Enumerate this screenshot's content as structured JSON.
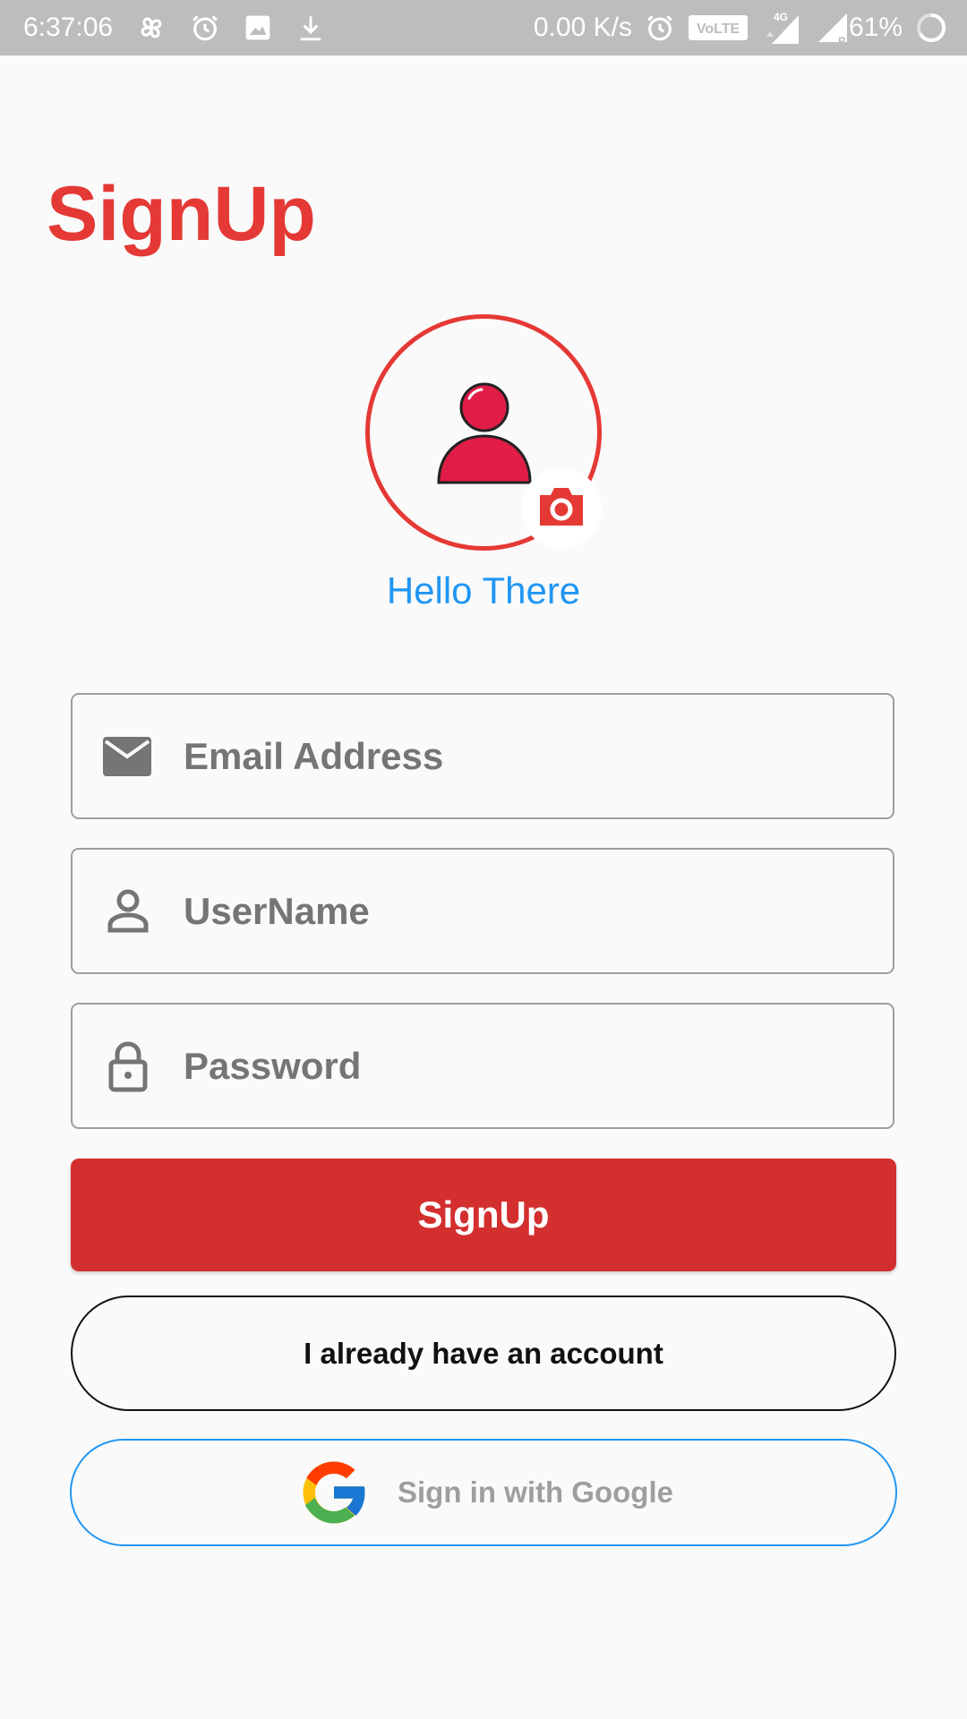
{
  "status_bar": {
    "time": "6:37:06",
    "left_icons": [
      "pinwheel-icon",
      "alarm-icon",
      "image-icon",
      "download-icon"
    ],
    "network_speed": "0.00 K/s",
    "volte": "VoLTE",
    "network_type": "4G",
    "roaming": "R",
    "battery": "61%"
  },
  "title": "SignUp",
  "avatar": {
    "greeting": "Hello There"
  },
  "form": {
    "email": {
      "placeholder": "Email Address",
      "icon": "mail-icon"
    },
    "username": {
      "placeholder": "UserName",
      "icon": "person-icon"
    },
    "password": {
      "placeholder": "Password",
      "icon": "lock-icon"
    }
  },
  "buttons": {
    "signup": "SignUp",
    "account": "I already have an account",
    "google": "Sign in with Google"
  },
  "colors": {
    "accent": "#e53935",
    "button": "#d32f2f",
    "link_blue": "#2196f3",
    "background": "#fafafa",
    "status_bar": "#bdbdbd"
  }
}
